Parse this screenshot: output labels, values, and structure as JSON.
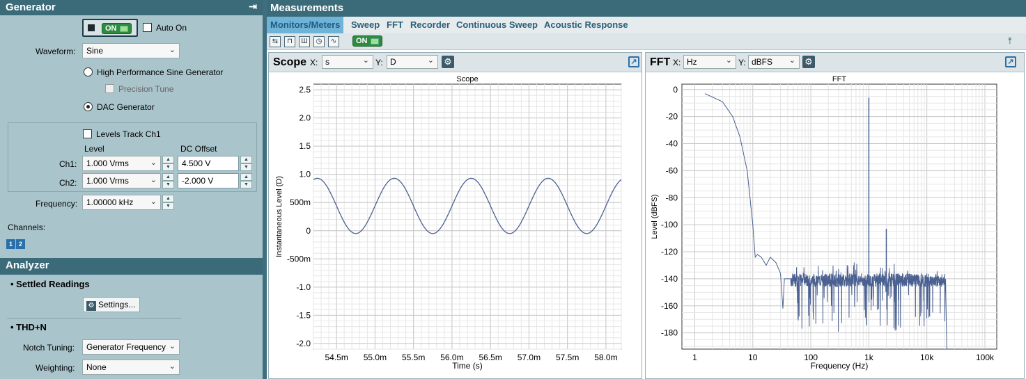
{
  "generator": {
    "title": "Generator",
    "on_label": "ON",
    "auto_on_label": "Auto On",
    "waveform_label": "Waveform:",
    "waveform_value": "Sine",
    "hp_sine_label": "High Performance Sine Generator",
    "precision_tune_label": "Precision Tune",
    "dac_label": "DAC Generator",
    "levels_track_label": "Levels Track Ch1",
    "level_header": "Level",
    "dc_offset_header": "DC Offset",
    "ch1_label": "Ch1:",
    "ch1_level": "1.000 Vrms",
    "ch1_offset": "4.500 V",
    "ch2_label": "Ch2:",
    "ch2_level": "1.000 Vrms",
    "ch2_offset": "-2.000 V",
    "frequency_label": "Frequency:",
    "frequency_value": "1.00000 kHz",
    "channels_label": "Channels:",
    "channel_1": "1",
    "channel_2": "2"
  },
  "analyzer": {
    "title": "Analyzer",
    "settled_readings": "Settled Readings",
    "settings_button": "Settings...",
    "thdn_title": "THD+N",
    "notch_label": "Notch Tuning:",
    "notch_value": "Generator Frequency",
    "weighting_label": "Weighting:",
    "weighting_value": "None"
  },
  "measurements": {
    "title": "Measurements",
    "tabs": [
      "Monitors/Meters",
      "Sweep",
      "FFT",
      "Recorder",
      "Continuous Sweep",
      "Acoustic Response"
    ],
    "on_label": "ON"
  },
  "scope": {
    "panel_title": "Scope",
    "x_label": "X:",
    "x_value": "s",
    "y_label": "Y:",
    "y_value": "D"
  },
  "fft": {
    "panel_title": "FFT",
    "x_label": "X:",
    "x_value": "Hz",
    "y_label": "Y:",
    "y_value": "dBFS"
  },
  "chart_data": [
    {
      "type": "line",
      "title": "Scope",
      "xlabel": "Time (s)",
      "ylabel": "Instantaneous Level (D)",
      "xlim": [
        0.0542,
        0.0582
      ],
      "ylim": [
        -2.1,
        2.6
      ],
      "x_ticks": [
        "54.5m",
        "55.0m",
        "55.5m",
        "56.0m",
        "56.5m",
        "57.0m",
        "57.5m",
        "58.0m"
      ],
      "x_tick_values": [
        0.0545,
        0.055,
        0.0555,
        0.056,
        0.0565,
        0.057,
        0.0575,
        0.058
      ],
      "y_ticks": [
        "2.5",
        "2.0",
        "1.5",
        "1.0",
        "500m",
        "0",
        "-500m",
        "-1.0",
        "-1.5",
        "-2.0"
      ],
      "y_tick_values": [
        2.5,
        2.0,
        1.5,
        1.0,
        0.5,
        0,
        -0.5,
        -1.0,
        -1.5,
        -2.0
      ],
      "series": [
        {
          "frequency_hz": 1000,
          "center": 0.44,
          "amplitude": 0.49,
          "phase_peak_s": 0.05425,
          "color": "#4a6090"
        }
      ],
      "grid": true
    },
    {
      "type": "line",
      "title": "FFT",
      "xlabel": "Frequency (Hz)",
      "ylabel": "Level (dBFS)",
      "x_scale": "log",
      "xlim": [
        0.6,
        160000
      ],
      "ylim": [
        -192,
        4
      ],
      "x_ticks": [
        "1",
        "10",
        "100",
        "1k",
        "10k",
        "100k"
      ],
      "x_tick_values": [
        1,
        10,
        100,
        1000,
        10000,
        100000
      ],
      "y_ticks": [
        "0",
        "-20",
        "-40",
        "-60",
        "-80",
        "-100",
        "-120",
        "-140",
        "-160",
        "-180"
      ],
      "y_tick_values": [
        0,
        -20,
        -40,
        -60,
        -80,
        -100,
        -120,
        -140,
        -160,
        -180
      ],
      "series": [
        {
          "color": "#4a6090",
          "points": [
            [
              1.5,
              -3
            ],
            [
              3,
              -9
            ],
            [
              4.5,
              -20
            ],
            [
              6,
              -35
            ],
            [
              8,
              -60
            ],
            [
              10,
              -100
            ],
            [
              11,
              -124
            ],
            [
              12,
              -122
            ],
            [
              14,
              -124
            ],
            [
              17,
              -130
            ],
            [
              20,
              -124
            ],
            [
              25,
              -128
            ],
            [
              30,
              -136
            ],
            [
              33,
              -162
            ],
            [
              35,
              -140
            ],
            [
              45,
              -140
            ],
            [
              1000,
              -140
            ],
            [
              23000,
              -140
            ]
          ],
          "peaks": [
            [
              1000,
              -6
            ],
            [
              2000,
              -103
            ]
          ],
          "noise_floor_db": -141,
          "noise_band_end_hz": 21000
        }
      ],
      "grid": true
    }
  ]
}
